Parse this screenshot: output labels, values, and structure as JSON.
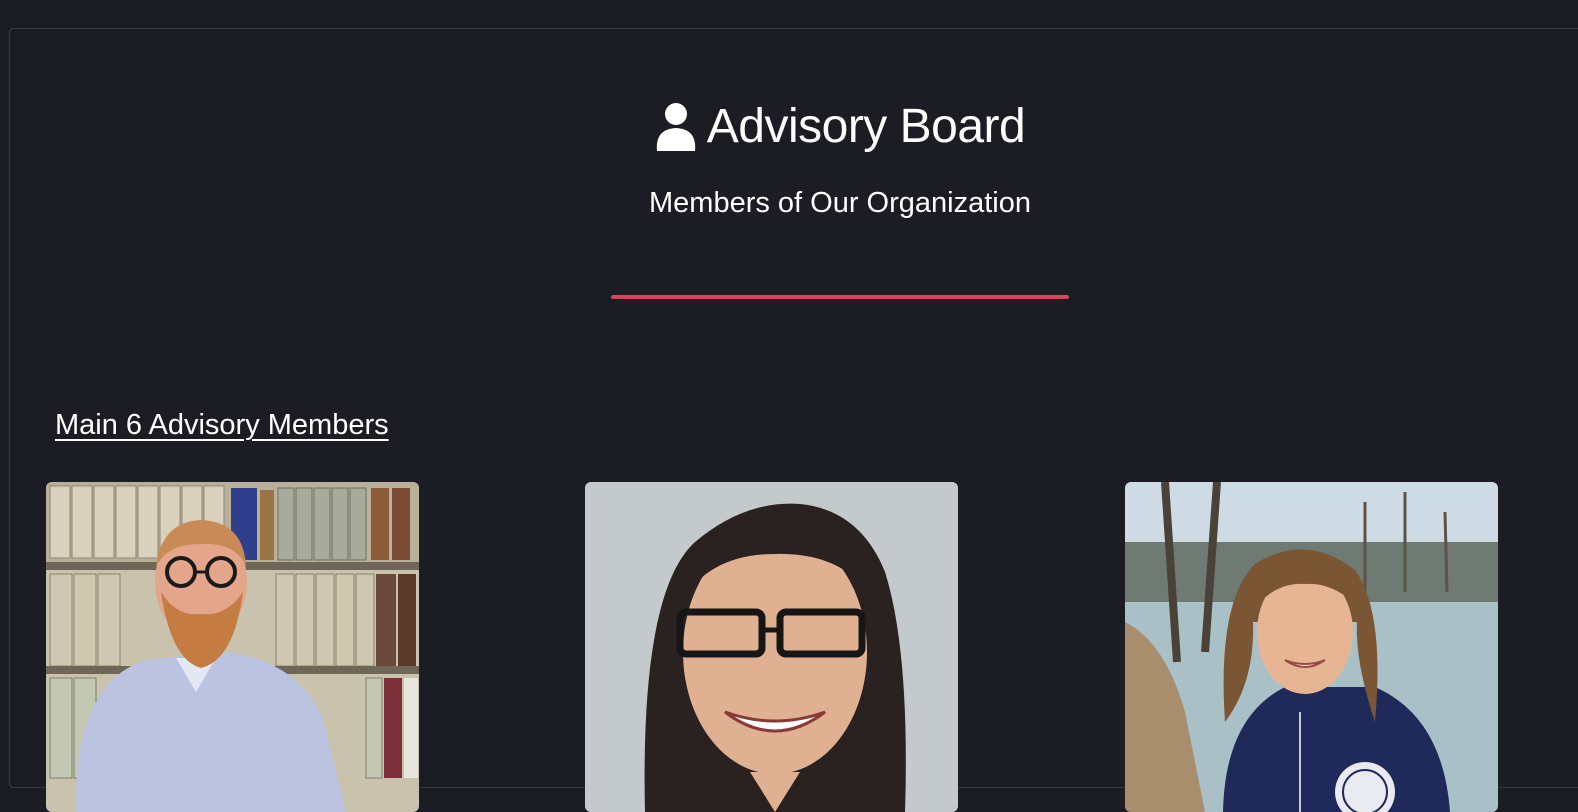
{
  "header": {
    "icon": "user-icon",
    "title": "Advisory Board",
    "subtitle": "Members of Our Organization"
  },
  "section": {
    "heading": "Main 6 Advisory Members"
  },
  "colors": {
    "background": "#1c1c24",
    "accent": "#e0415e",
    "text": "#ffffff"
  },
  "members": [
    {
      "photo": "member-photo-man-bookshelf"
    },
    {
      "photo": "member-photo-woman-glasses"
    },
    {
      "photo": "member-photo-woman-lake"
    }
  ]
}
